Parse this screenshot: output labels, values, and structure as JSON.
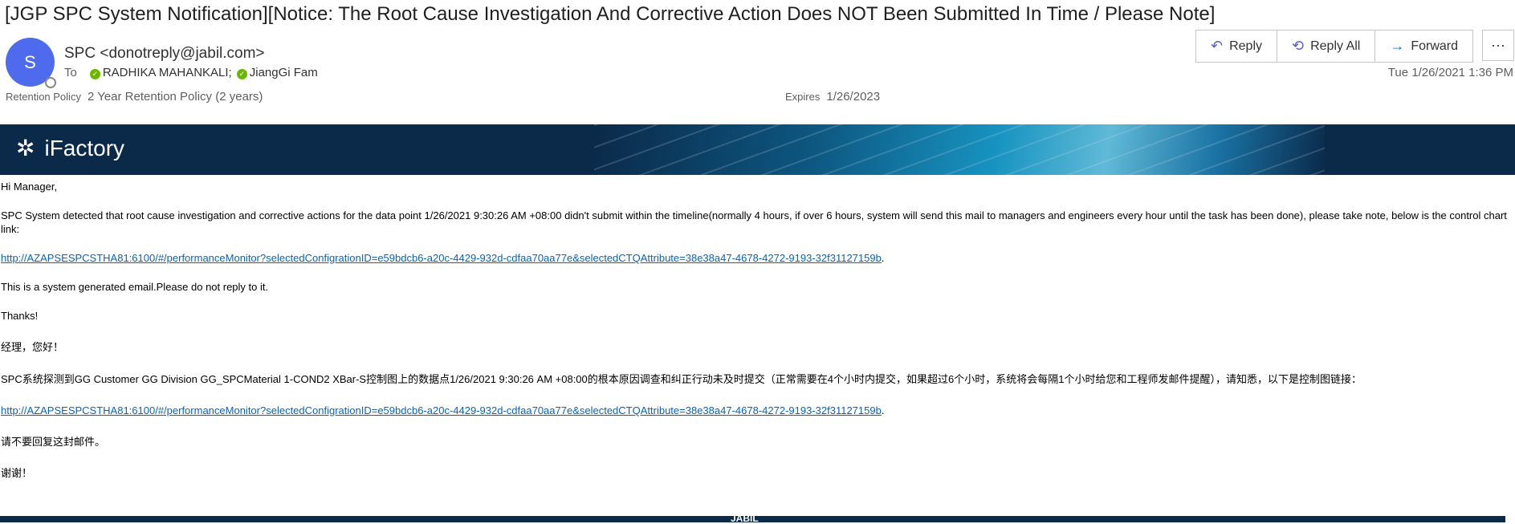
{
  "email": {
    "subject": "[JGP SPC System Notification][Notice: The Root Cause Investigation And Corrective Action Does NOT Been Submitted In Time / Please Note]",
    "avatar_letter": "S",
    "sender": "SPC <donotreply@jabil.com>",
    "to_label": "To",
    "recipients": [
      "RADHIKA MAHANKALI;",
      "JiangGi Fam"
    ],
    "retention_label": "Retention Policy",
    "retention_value": "2 Year Retention Policy (2 years)",
    "expires_label": "Expires",
    "expires_value": "1/26/2023",
    "date": "Tue 1/26/2021 1:36 PM"
  },
  "actions": {
    "reply": "Reply",
    "reply_all": "Reply All",
    "forward": "Forward",
    "more": "···"
  },
  "banner": {
    "brand": "iFactory"
  },
  "body": {
    "greeting_en": "Hi Manager,",
    "detect_en": "SPC System detected that root cause investigation and corrective actions for the data point 1/26/2021 9:30:26 AM +08:00 didn't submit within the timeline(normally 4 hours, if over 6 hours, system will send this mail to managers and engineers every hour until the task has been done), please take note, below is the control chart link:",
    "link": "http://AZAPSESPCSTHA81:6100/#/performanceMonitor?selectedConfigrationID=e59bdcb6-a20c-4429-932d-cdfaa70aa77e&selectedCTQAttribute=38e38a47-4678-4272-9193-32f31127159b",
    "auto_en": "This is a system generated email.Please do not reply to it.",
    "thanks_en": "Thanks!",
    "greeting_cn": "经理，您好！",
    "detect_cn": "SPC系统探测到GG Customer GG Division GG_SPCMaterial 1-COND2 XBar-S控制图上的数据点1/26/2021 9:30:26 AM +08:00的根本原因调查和纠正行动未及时提交（正常需要在4个小时内提交，如果超过6个小时，系统将会每隔1个小时给您和工程师发邮件提醒），请知悉，以下是控制图链接：",
    "auto_cn": "请不要回复这封邮件。",
    "thanks_cn": "谢谢！"
  },
  "footer": {
    "brand": "JABIL"
  }
}
